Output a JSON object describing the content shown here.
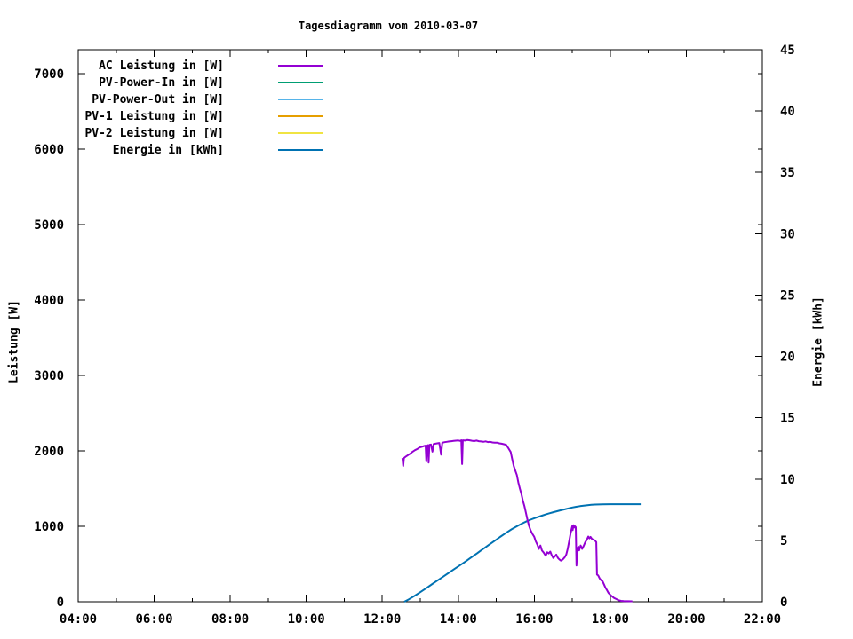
{
  "title": "Tagesdiagramm vom 2010-03-07",
  "left_axis": {
    "label": "Leistung [W]",
    "min": 0,
    "max": 7318,
    "tick_values": [
      0,
      1000,
      2000,
      3000,
      4000,
      5000,
      6000,
      7000
    ],
    "tick_labels": [
      "0",
      "1000",
      "2000",
      "3000",
      "4000",
      "5000",
      "6000",
      "7000"
    ]
  },
  "right_axis": {
    "label": "Energie [kWh]",
    "min": 0,
    "max": 45,
    "tick_values": [
      0,
      5,
      10,
      15,
      20,
      25,
      30,
      35,
      40,
      45
    ],
    "tick_labels": [
      "0",
      "5",
      "10",
      "15",
      "20",
      "25",
      "30",
      "35",
      "40",
      "45"
    ]
  },
  "x_axis": {
    "min": 4,
    "max": 22,
    "major_tick_values": [
      4,
      6,
      8,
      10,
      12,
      14,
      16,
      18,
      20,
      22
    ],
    "major_tick_labels": [
      "04:00",
      "06:00",
      "08:00",
      "10:00",
      "12:00",
      "14:00",
      "16:00",
      "18:00",
      "20:00",
      "22:00"
    ],
    "minor_tick_values": [
      5,
      7,
      9,
      11,
      13,
      15,
      17,
      19,
      21
    ]
  },
  "chart_data": {
    "type": "line",
    "title": "Tagesdiagramm vom 2010-03-07",
    "x_unit": "time of day [hours]",
    "grid": false,
    "legend_position": "top-left-inside",
    "xlim": [
      4,
      22
    ],
    "ylim_left_watt": [
      0,
      7318
    ],
    "ylim_right_kwh": [
      0,
      45
    ],
    "series": [
      {
        "name": "AC Leistung in [W]",
        "color": "#9400d3",
        "axis": "left",
        "points": [
          [
            12.53,
            1905
          ],
          [
            12.55,
            1800
          ],
          [
            12.57,
            1905
          ],
          [
            12.62,
            1925
          ],
          [
            12.68,
            1945
          ],
          [
            12.74,
            1965
          ],
          [
            12.8,
            1990
          ],
          [
            12.86,
            2010
          ],
          [
            12.92,
            2025
          ],
          [
            12.98,
            2045
          ],
          [
            13.05,
            2055
          ],
          [
            13.1,
            2065
          ],
          [
            13.14,
            2070
          ],
          [
            13.16,
            1860
          ],
          [
            13.18,
            2070
          ],
          [
            13.2,
            2075
          ],
          [
            13.22,
            1845
          ],
          [
            13.24,
            2080
          ],
          [
            13.28,
            2085
          ],
          [
            13.32,
            1990
          ],
          [
            13.35,
            2090
          ],
          [
            13.4,
            2095
          ],
          [
            13.45,
            2100
          ],
          [
            13.5,
            2105
          ],
          [
            13.55,
            1950
          ],
          [
            13.58,
            2108
          ],
          [
            13.64,
            2115
          ],
          [
            13.7,
            2120
          ],
          [
            13.76,
            2125
          ],
          [
            13.82,
            2128
          ],
          [
            13.88,
            2132
          ],
          [
            13.94,
            2135
          ],
          [
            14.0,
            2138
          ],
          [
            14.05,
            2132
          ],
          [
            14.08,
            2140
          ],
          [
            14.1,
            1825
          ],
          [
            14.12,
            2140
          ],
          [
            14.18,
            2136
          ],
          [
            14.24,
            2145
          ],
          [
            14.3,
            2140
          ],
          [
            14.36,
            2134
          ],
          [
            14.42,
            2130
          ],
          [
            14.48,
            2136
          ],
          [
            14.54,
            2128
          ],
          [
            14.6,
            2125
          ],
          [
            14.66,
            2120
          ],
          [
            14.72,
            2126
          ],
          [
            14.78,
            2116
          ],
          [
            14.84,
            2120
          ],
          [
            14.9,
            2112
          ],
          [
            14.96,
            2108
          ],
          [
            15.02,
            2110
          ],
          [
            15.08,
            2100
          ],
          [
            15.14,
            2095
          ],
          [
            15.2,
            2088
          ],
          [
            15.26,
            2080
          ],
          [
            15.32,
            2035
          ],
          [
            15.38,
            1985
          ],
          [
            15.42,
            1890
          ],
          [
            15.46,
            1800
          ],
          [
            15.5,
            1740
          ],
          [
            15.54,
            1680
          ],
          [
            15.58,
            1580
          ],
          [
            15.62,
            1500
          ],
          [
            15.66,
            1430
          ],
          [
            15.7,
            1340
          ],
          [
            15.74,
            1270
          ],
          [
            15.78,
            1180
          ],
          [
            15.82,
            1090
          ],
          [
            15.86,
            1010
          ],
          [
            15.9,
            950
          ],
          [
            15.95,
            900
          ],
          [
            16.0,
            860
          ],
          [
            16.04,
            800
          ],
          [
            16.08,
            755
          ],
          [
            16.12,
            700
          ],
          [
            16.16,
            745
          ],
          [
            16.2,
            680
          ],
          [
            16.25,
            650
          ],
          [
            16.3,
            610
          ],
          [
            16.34,
            655
          ],
          [
            16.38,
            640
          ],
          [
            16.42,
            665
          ],
          [
            16.46,
            615
          ],
          [
            16.5,
            580
          ],
          [
            16.54,
            600
          ],
          [
            16.58,
            625
          ],
          [
            16.62,
            580
          ],
          [
            16.66,
            560
          ],
          [
            16.7,
            545
          ],
          [
            16.75,
            560
          ],
          [
            16.8,
            590
          ],
          [
            16.84,
            625
          ],
          [
            16.88,
            705
          ],
          [
            16.92,
            810
          ],
          [
            16.95,
            895
          ],
          [
            16.98,
            965
          ],
          [
            17.0,
            1005
          ],
          [
            17.01,
            950
          ],
          [
            17.03,
            1015
          ],
          [
            17.05,
            985
          ],
          [
            17.07,
            1000
          ],
          [
            17.09,
            990
          ],
          [
            17.11,
            480
          ],
          [
            17.13,
            705
          ],
          [
            17.16,
            730
          ],
          [
            17.18,
            680
          ],
          [
            17.22,
            745
          ],
          [
            17.26,
            700
          ],
          [
            17.3,
            740
          ],
          [
            17.34,
            790
          ],
          [
            17.38,
            820
          ],
          [
            17.42,
            865
          ],
          [
            17.45,
            840
          ],
          [
            17.48,
            860
          ],
          [
            17.52,
            830
          ],
          [
            17.56,
            822
          ],
          [
            17.6,
            810
          ],
          [
            17.63,
            790
          ],
          [
            17.65,
            360
          ],
          [
            17.68,
            350
          ],
          [
            17.72,
            310
          ],
          [
            17.76,
            285
          ],
          [
            17.8,
            268
          ],
          [
            17.84,
            225
          ],
          [
            17.87,
            190
          ],
          [
            17.91,
            155
          ],
          [
            17.95,
            118
          ],
          [
            18.0,
            92
          ],
          [
            18.05,
            70
          ],
          [
            18.1,
            50
          ],
          [
            18.16,
            35
          ],
          [
            18.22,
            20
          ],
          [
            18.28,
            12
          ],
          [
            18.35,
            8
          ],
          [
            18.58,
            6
          ]
        ]
      },
      {
        "name": "PV-Power-In in [W]",
        "color": "#009e73",
        "axis": "left",
        "points": []
      },
      {
        "name": "PV-Power-Out in [W]",
        "color": "#56b4e9",
        "axis": "left",
        "points": []
      },
      {
        "name": "PV-1 Leistung in [W]",
        "color": "#e69f00",
        "axis": "left",
        "points": []
      },
      {
        "name": "PV-2 Leistung in [W]",
        "color": "#f0e442",
        "axis": "left",
        "points": []
      },
      {
        "name": "Energie in [kWh]",
        "color": "#0072b2",
        "axis": "right",
        "points": [
          [
            12.58,
            0
          ],
          [
            12.7,
            0.2
          ],
          [
            12.8,
            0.38
          ],
          [
            12.9,
            0.58
          ],
          [
            13.0,
            0.78
          ],
          [
            13.1,
            0.99
          ],
          [
            13.2,
            1.2
          ],
          [
            13.3,
            1.41
          ],
          [
            13.4,
            1.62
          ],
          [
            13.5,
            1.83
          ],
          [
            13.6,
            2.04
          ],
          [
            13.7,
            2.25
          ],
          [
            13.8,
            2.46
          ],
          [
            13.9,
            2.67
          ],
          [
            14.0,
            2.88
          ],
          [
            14.1,
            3.09
          ],
          [
            14.2,
            3.3
          ],
          [
            14.3,
            3.52
          ],
          [
            14.4,
            3.74
          ],
          [
            14.5,
            3.96
          ],
          [
            14.6,
            4.18
          ],
          [
            14.7,
            4.4
          ],
          [
            14.8,
            4.62
          ],
          [
            14.9,
            4.84
          ],
          [
            15.0,
            5.06
          ],
          [
            15.1,
            5.28
          ],
          [
            15.2,
            5.49
          ],
          [
            15.3,
            5.7
          ],
          [
            15.4,
            5.9
          ],
          [
            15.5,
            6.08
          ],
          [
            15.6,
            6.25
          ],
          [
            15.7,
            6.41
          ],
          [
            15.8,
            6.56
          ],
          [
            15.9,
            6.69
          ],
          [
            16.0,
            6.81
          ],
          [
            16.1,
            6.92
          ],
          [
            16.2,
            7.02
          ],
          [
            16.3,
            7.12
          ],
          [
            16.4,
            7.21
          ],
          [
            16.5,
            7.3
          ],
          [
            16.6,
            7.38
          ],
          [
            16.7,
            7.46
          ],
          [
            16.8,
            7.53
          ],
          [
            16.9,
            7.61
          ],
          [
            17.0,
            7.68
          ],
          [
            17.1,
            7.74
          ],
          [
            17.2,
            7.79
          ],
          [
            17.3,
            7.83
          ],
          [
            17.4,
            7.87
          ],
          [
            17.5,
            7.9
          ],
          [
            17.6,
            7.92
          ],
          [
            17.7,
            7.93
          ],
          [
            17.8,
            7.94
          ],
          [
            18.0,
            7.95
          ],
          [
            18.4,
            7.95
          ],
          [
            18.8,
            7.95
          ]
        ]
      }
    ]
  }
}
